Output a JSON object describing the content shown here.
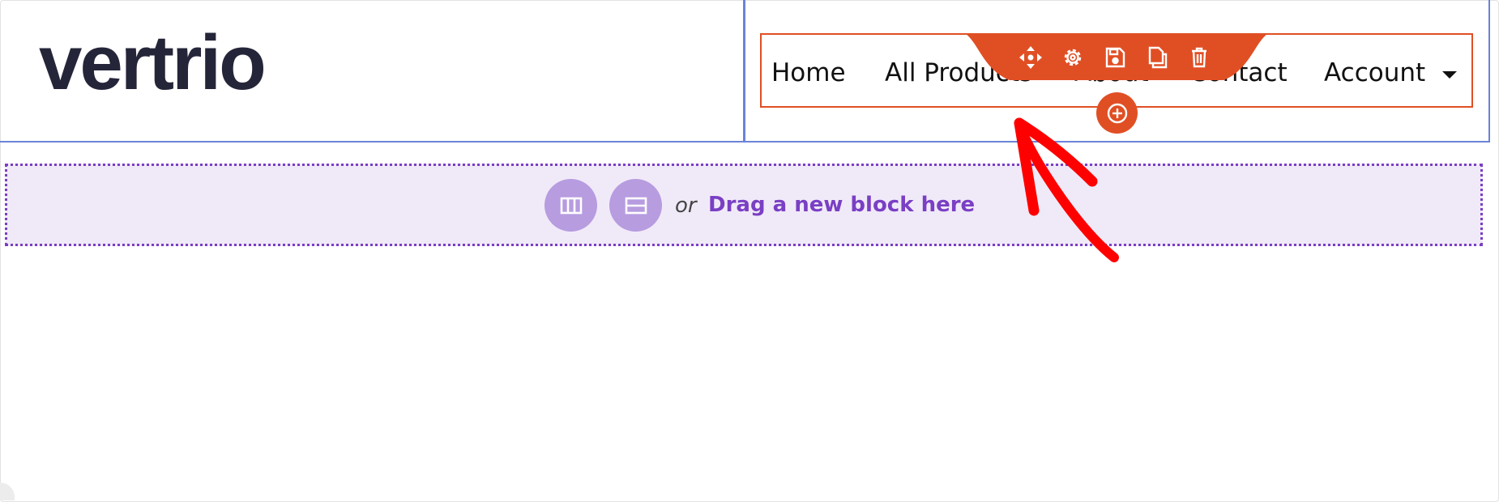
{
  "logo": {
    "text": "vertrio",
    "color": "#25253a"
  },
  "nav": {
    "items": [
      "Home",
      "All Products",
      "About",
      "Contact",
      "Account"
    ],
    "account_has_dropdown": true,
    "selected_border_color": "#e04f24"
  },
  "toolbar": {
    "color": "#e04f24",
    "icons": [
      "move-icon",
      "settings-icon",
      "save-icon",
      "duplicate-icon",
      "delete-icon"
    ],
    "add_icon": "plus-circle-icon"
  },
  "dropzone": {
    "or_label": "or",
    "drag_label": "Drag a new block here",
    "buttons": [
      "columns-icon",
      "rows-icon"
    ],
    "accent_color": "#7a3fc4",
    "background_color": "#f0eaf8"
  },
  "annotation": {
    "type": "arrow",
    "color": "#ff0000"
  }
}
